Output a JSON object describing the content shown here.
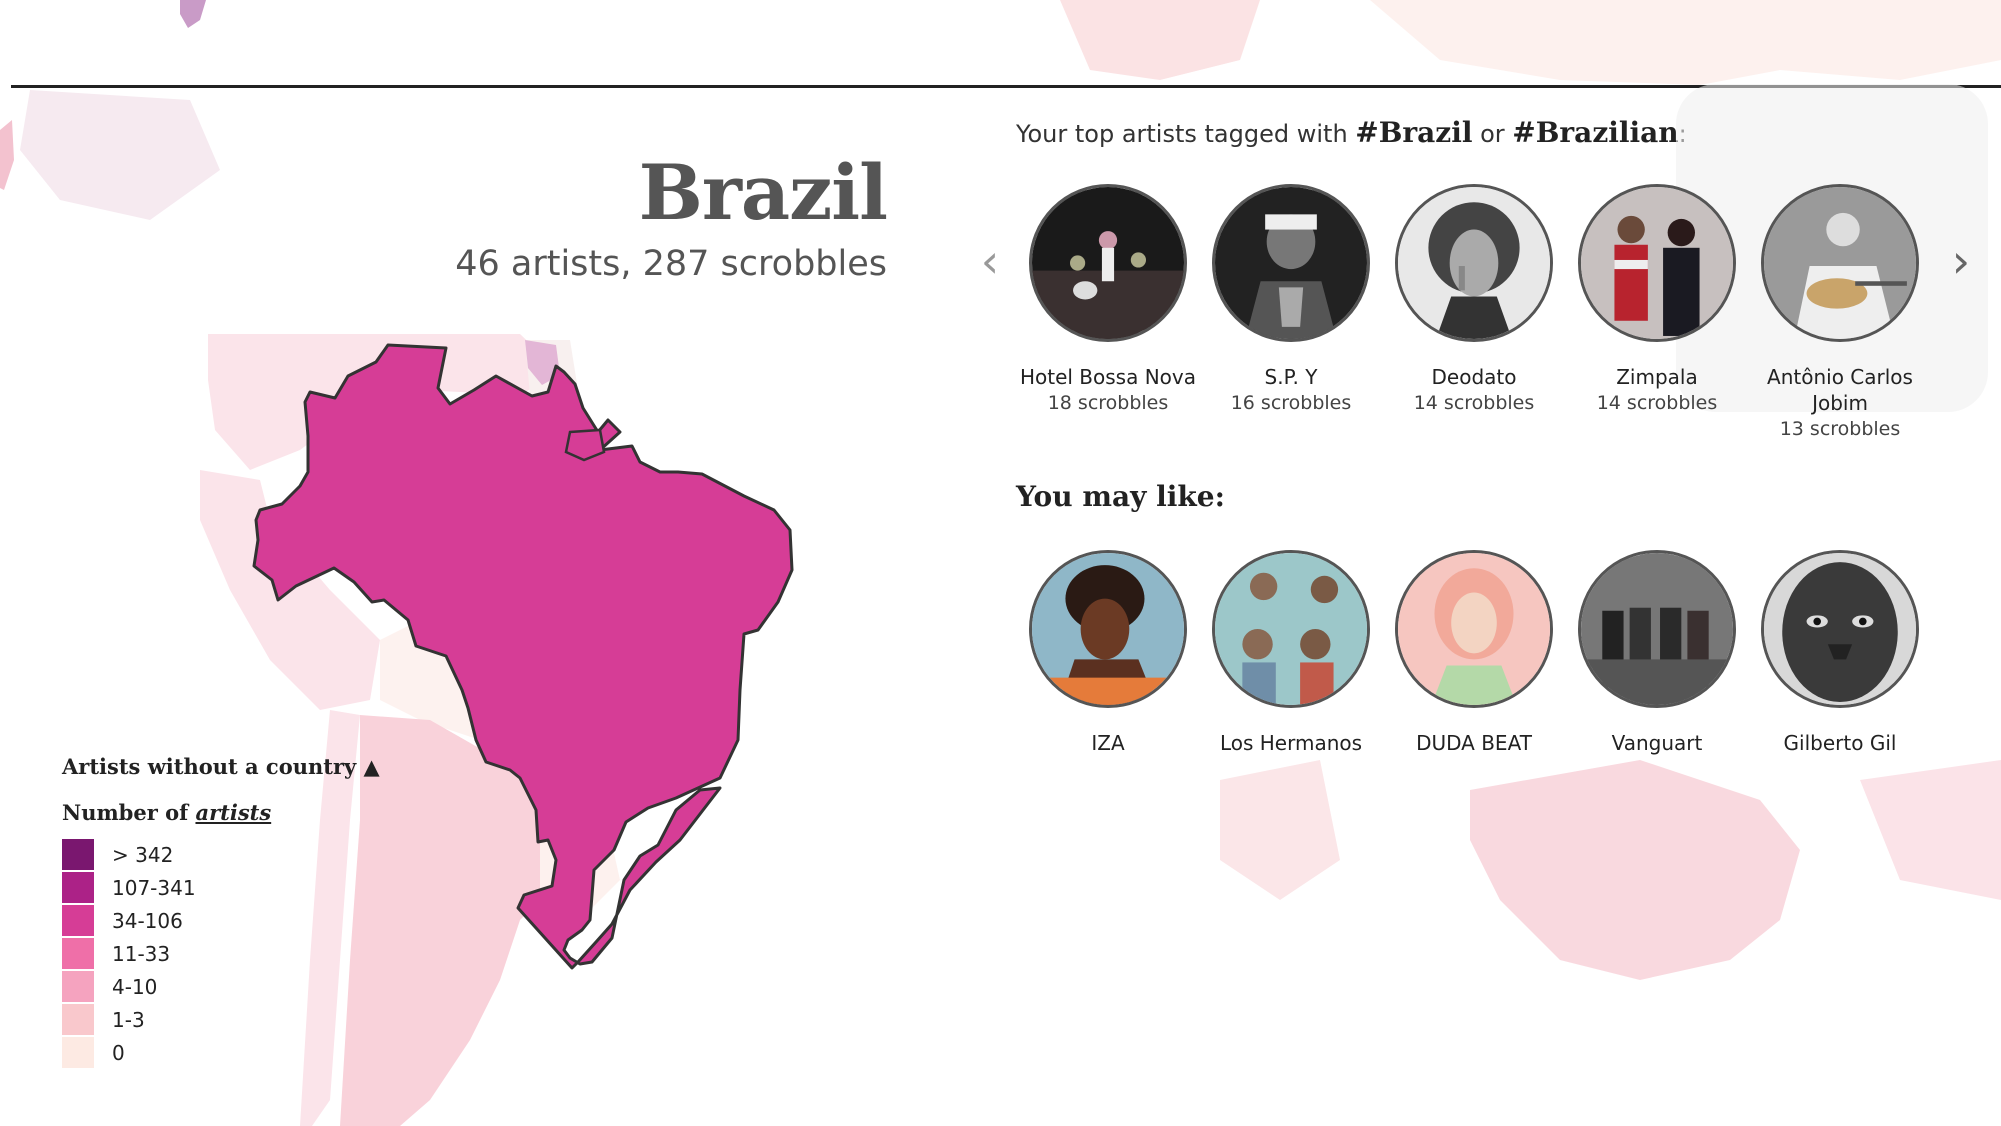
{
  "country": {
    "name": "Brazil",
    "summary": "46 artists, 287 scrobbles"
  },
  "top_artists": {
    "title_prefix": "Your top artists tagged with ",
    "tag1": "#Brazil",
    "middle": " or ",
    "tag2": "#Brazilian",
    "suffix": ":",
    "prev_arrow": "‹",
    "next_arrow": "›",
    "items": [
      {
        "name": "Hotel Bossa Nova",
        "count": "18 scrobbles"
      },
      {
        "name": "S.P. Y",
        "count": "16 scrobbles"
      },
      {
        "name": "Deodato",
        "count": "14 scrobbles"
      },
      {
        "name": "Zimpala",
        "count": "14 scrobbles"
      },
      {
        "name": "Antônio Carlos Jobim",
        "count": "13 scrobbles"
      }
    ]
  },
  "may_like": {
    "title": "You may like:",
    "items": [
      {
        "name": "IZA"
      },
      {
        "name": "Los Hermanos"
      },
      {
        "name": "DUDA BEAT"
      },
      {
        "name": "Vanguart"
      },
      {
        "name": "Gilberto Gil"
      }
    ]
  },
  "legend": {
    "no_country": "Artists without a country ▲",
    "title_prefix": "Number of ",
    "title_link": "artists",
    "items": [
      {
        "label": "> 342",
        "color": "#7a176f"
      },
      {
        "label": "107-341",
        "color": "#ac2287"
      },
      {
        "label": "34-106",
        "color": "#d63d96"
      },
      {
        "label": "11-33",
        "color": "#ef6fa8"
      },
      {
        "label": "4-10",
        "color": "#f5a3bf"
      },
      {
        "label": "1-3",
        "color": "#f9c8cc"
      },
      {
        "label": "0",
        "color": "#fdeae3"
      }
    ]
  },
  "colors": {
    "highlight": "#d63d96",
    "border": "#333333"
  }
}
